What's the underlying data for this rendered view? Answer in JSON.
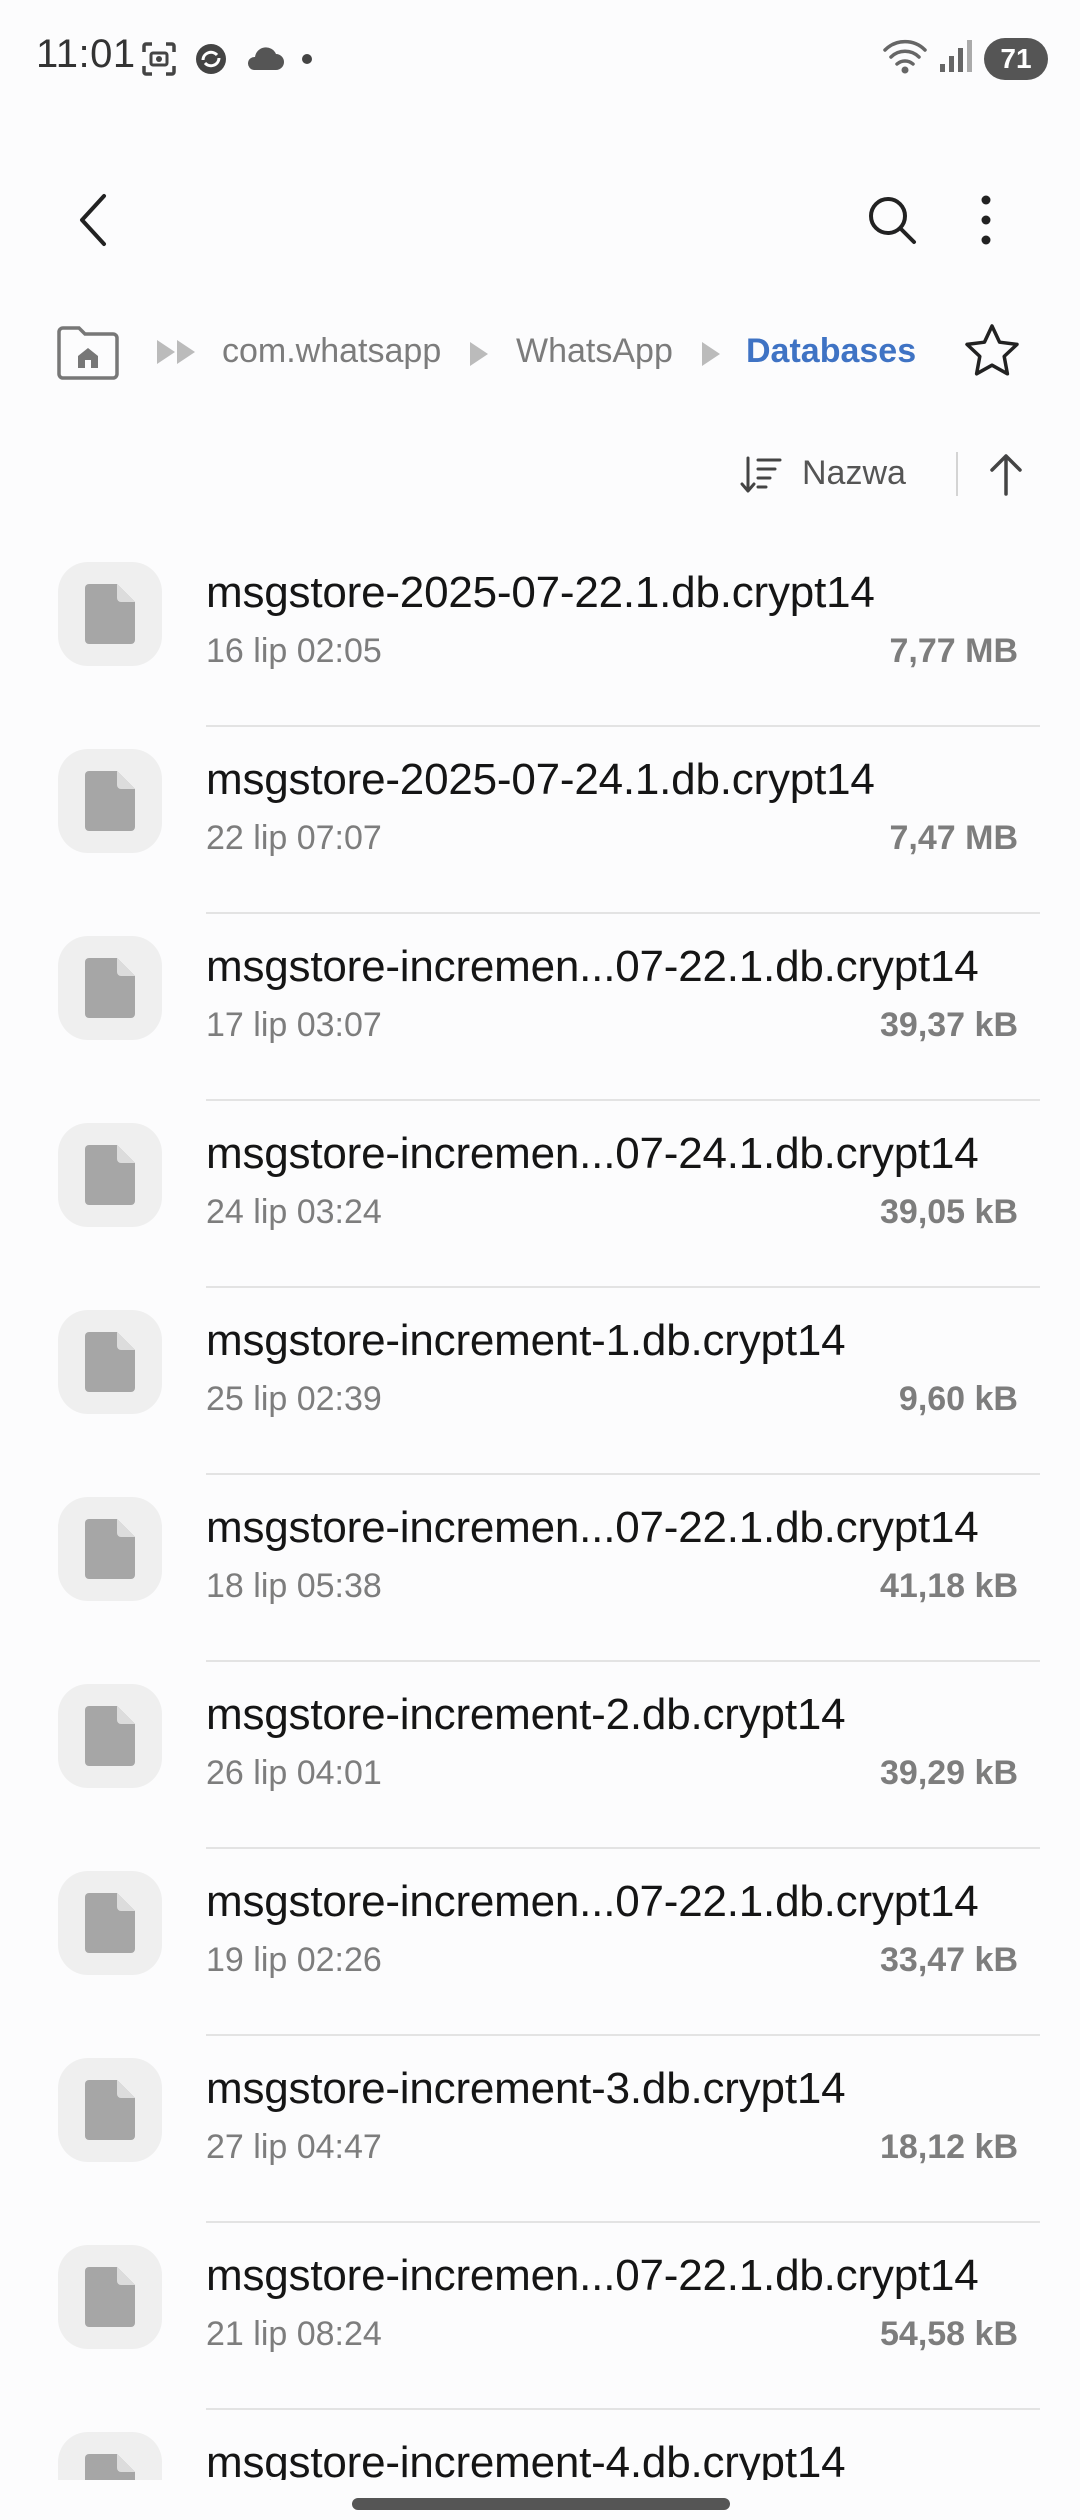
{
  "status_bar": {
    "time": "11:01",
    "battery": "71"
  },
  "app_bar": {
    "back_icon": "chevron-left-icon",
    "search_icon": "search-icon",
    "more_icon": "more-vert-icon"
  },
  "breadcrumb": {
    "home_icon": "home-folder-icon",
    "items": [
      "com.whatsapp",
      "WhatsApp",
      "Databases"
    ],
    "active_color": "#3f73c4"
  },
  "sort": {
    "label": "Nazwa",
    "direction_icon": "arrow-up-icon"
  },
  "files": [
    {
      "name": "msgstore-2025-07-22.1.db.crypt14",
      "date": "16 lip 02:05",
      "size": "7,77 MB"
    },
    {
      "name": "msgstore-2025-07-24.1.db.crypt14",
      "date": "22 lip 07:07",
      "size": "7,47 MB"
    },
    {
      "name": "msgstore-incremen...07-22.1.db.crypt14",
      "date": "17 lip 03:07",
      "size": "39,37 kB"
    },
    {
      "name": "msgstore-incremen...07-24.1.db.crypt14",
      "date": "24 lip 03:24",
      "size": "39,05 kB"
    },
    {
      "name": "msgstore-increment-1.db.crypt14",
      "date": "25 lip 02:39",
      "size": "9,60 kB"
    },
    {
      "name": "msgstore-incremen...07-22.1.db.crypt14",
      "date": "18 lip 05:38",
      "size": "41,18 kB"
    },
    {
      "name": "msgstore-increment-2.db.crypt14",
      "date": "26 lip 04:01",
      "size": "39,29 kB"
    },
    {
      "name": "msgstore-incremen...07-22.1.db.crypt14",
      "date": "19 lip 02:26",
      "size": "33,47 kB"
    },
    {
      "name": "msgstore-increment-3.db.crypt14",
      "date": "27 lip 04:47",
      "size": "18,12 kB"
    },
    {
      "name": "msgstore-incremen...07-22.1.db.crypt14",
      "date": "21 lip 08:24",
      "size": "54,58 kB"
    },
    {
      "name": "msgstore-increment-4.db.crypt14",
      "date": "",
      "size": ""
    }
  ]
}
